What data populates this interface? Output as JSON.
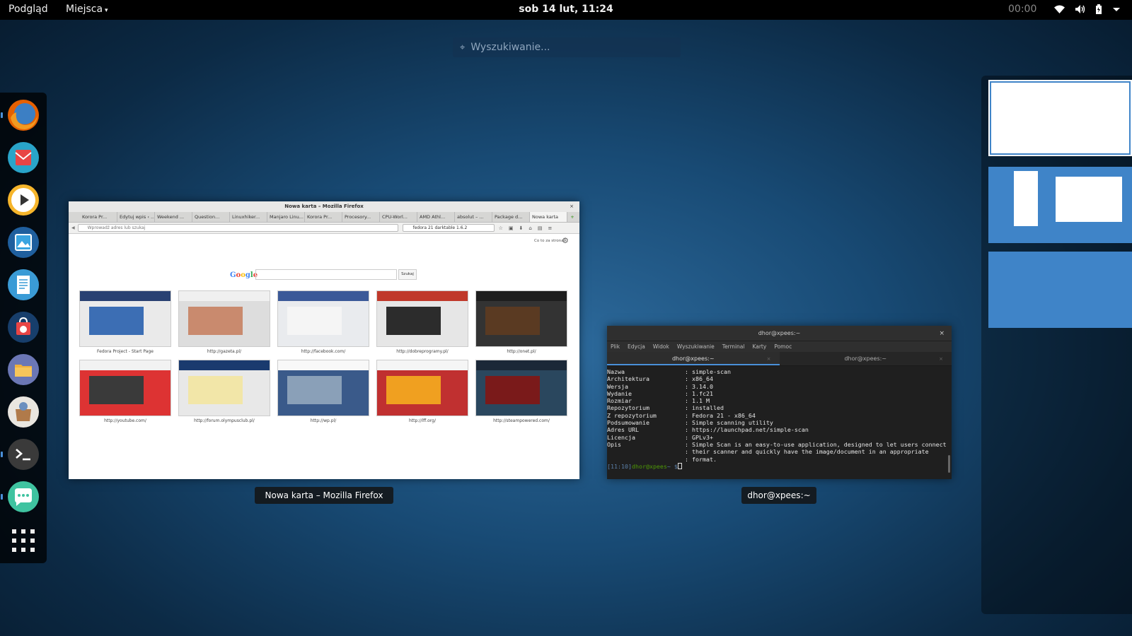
{
  "topbar": {
    "activities": "Podgląd",
    "places": "Miejsca",
    "clock": "sob 14 lut, 11:24",
    "timer": "00:00",
    "tray_icons": [
      "wifi-icon",
      "volume-icon",
      "battery-icon",
      "system-menu-caret-icon"
    ]
  },
  "search": {
    "placeholder": "Wyszukiwanie..."
  },
  "dash": {
    "items": [
      {
        "name": "firefox",
        "running": true
      },
      {
        "name": "mail",
        "running": false
      },
      {
        "name": "media-player",
        "running": false
      },
      {
        "name": "image-viewer",
        "running": false
      },
      {
        "name": "text-editor",
        "running": false
      },
      {
        "name": "software-center",
        "running": false
      },
      {
        "name": "files",
        "running": false
      },
      {
        "name": "shop",
        "running": false
      },
      {
        "name": "terminal",
        "running": true
      },
      {
        "name": "chat",
        "running": true
      }
    ]
  },
  "firefox": {
    "caption": "Nowa karta – Mozilla Firefox",
    "title": "Nowa karta – Mozilla Firefox",
    "tabs": [
      "Korora Pr...",
      "Edytuj wpis ‹ ...",
      "Weekend ...",
      "Question...",
      "Linuxhiker...",
      "Manjaro Linu...",
      "Korora Pr...",
      "Procesory...",
      "CPU-Worl...",
      "AMD Athl...",
      "absolut – ...",
      "Package d...",
      "Nowa karta"
    ],
    "url_placeholder": "Wprowadź adres lub szukaj",
    "search_value": "fedora 21 darktable 1.6.2",
    "what_is": "Co to za strona?",
    "google_button": "Szukaj",
    "google_logo": "Google",
    "tiles": [
      {
        "label": "Fedora Project - Start Page"
      },
      {
        "label": "http://gazeta.pl/"
      },
      {
        "label": "http://facebook.com/"
      },
      {
        "label": "http://dobreprogramy.pl/"
      },
      {
        "label": "http://onet.pl/"
      },
      {
        "label": "http://youtube.com/"
      },
      {
        "label": "http://forum.olympusclub.pl/"
      },
      {
        "label": "http://wp.pl/"
      },
      {
        "label": "http://lff.org/"
      },
      {
        "label": "http://steampowered.com/"
      }
    ]
  },
  "terminal": {
    "caption": "dhor@xpees:~",
    "title": "dhor@xpees:~",
    "menu": [
      "Plik",
      "Edycja",
      "Widok",
      "Wyszukiwanie",
      "Terminal",
      "Karty",
      "Pomoc"
    ],
    "tabs": [
      "dhor@xpees:~",
      "dhor@xpees:~"
    ],
    "lines": [
      {
        "key": "Nazwa",
        "val": ": simple-scan"
      },
      {
        "key": "Architektura",
        "val": ": x86_64"
      },
      {
        "key": "Wersja",
        "val": ": 3.14.0"
      },
      {
        "key": "Wydanie",
        "val": ": 1.fc21"
      },
      {
        "key": "Rozmiar",
        "val": ": 1.1 M"
      },
      {
        "key": "Repozytorium",
        "val": ": installed"
      },
      {
        "key": "Z repozytorium",
        "val": ": Fedora 21 - x86_64"
      },
      {
        "key": "Podsumowanie",
        "val": ": Simple scanning utility"
      },
      {
        "key": "Adres URL",
        "val": ": https://launchpad.net/simple-scan"
      },
      {
        "key": "Licencja",
        "val": ": GPLv3+"
      },
      {
        "key": "Opis",
        "val": ": Simple Scan is an easy-to-use application, designed to let users connect"
      },
      {
        "key": "",
        "val": ": their scanner and quickly have the image/document in an appropriate"
      },
      {
        "key": "",
        "val": ": format."
      }
    ],
    "prompt_time": "[11:10]",
    "prompt_user": "dhor@xpees",
    "prompt_rest": "~ $"
  },
  "workspaces": {
    "count": 3,
    "active": 1
  },
  "colors": {
    "accent": "#4a90d9",
    "terminal_green": "#4e9a06"
  }
}
